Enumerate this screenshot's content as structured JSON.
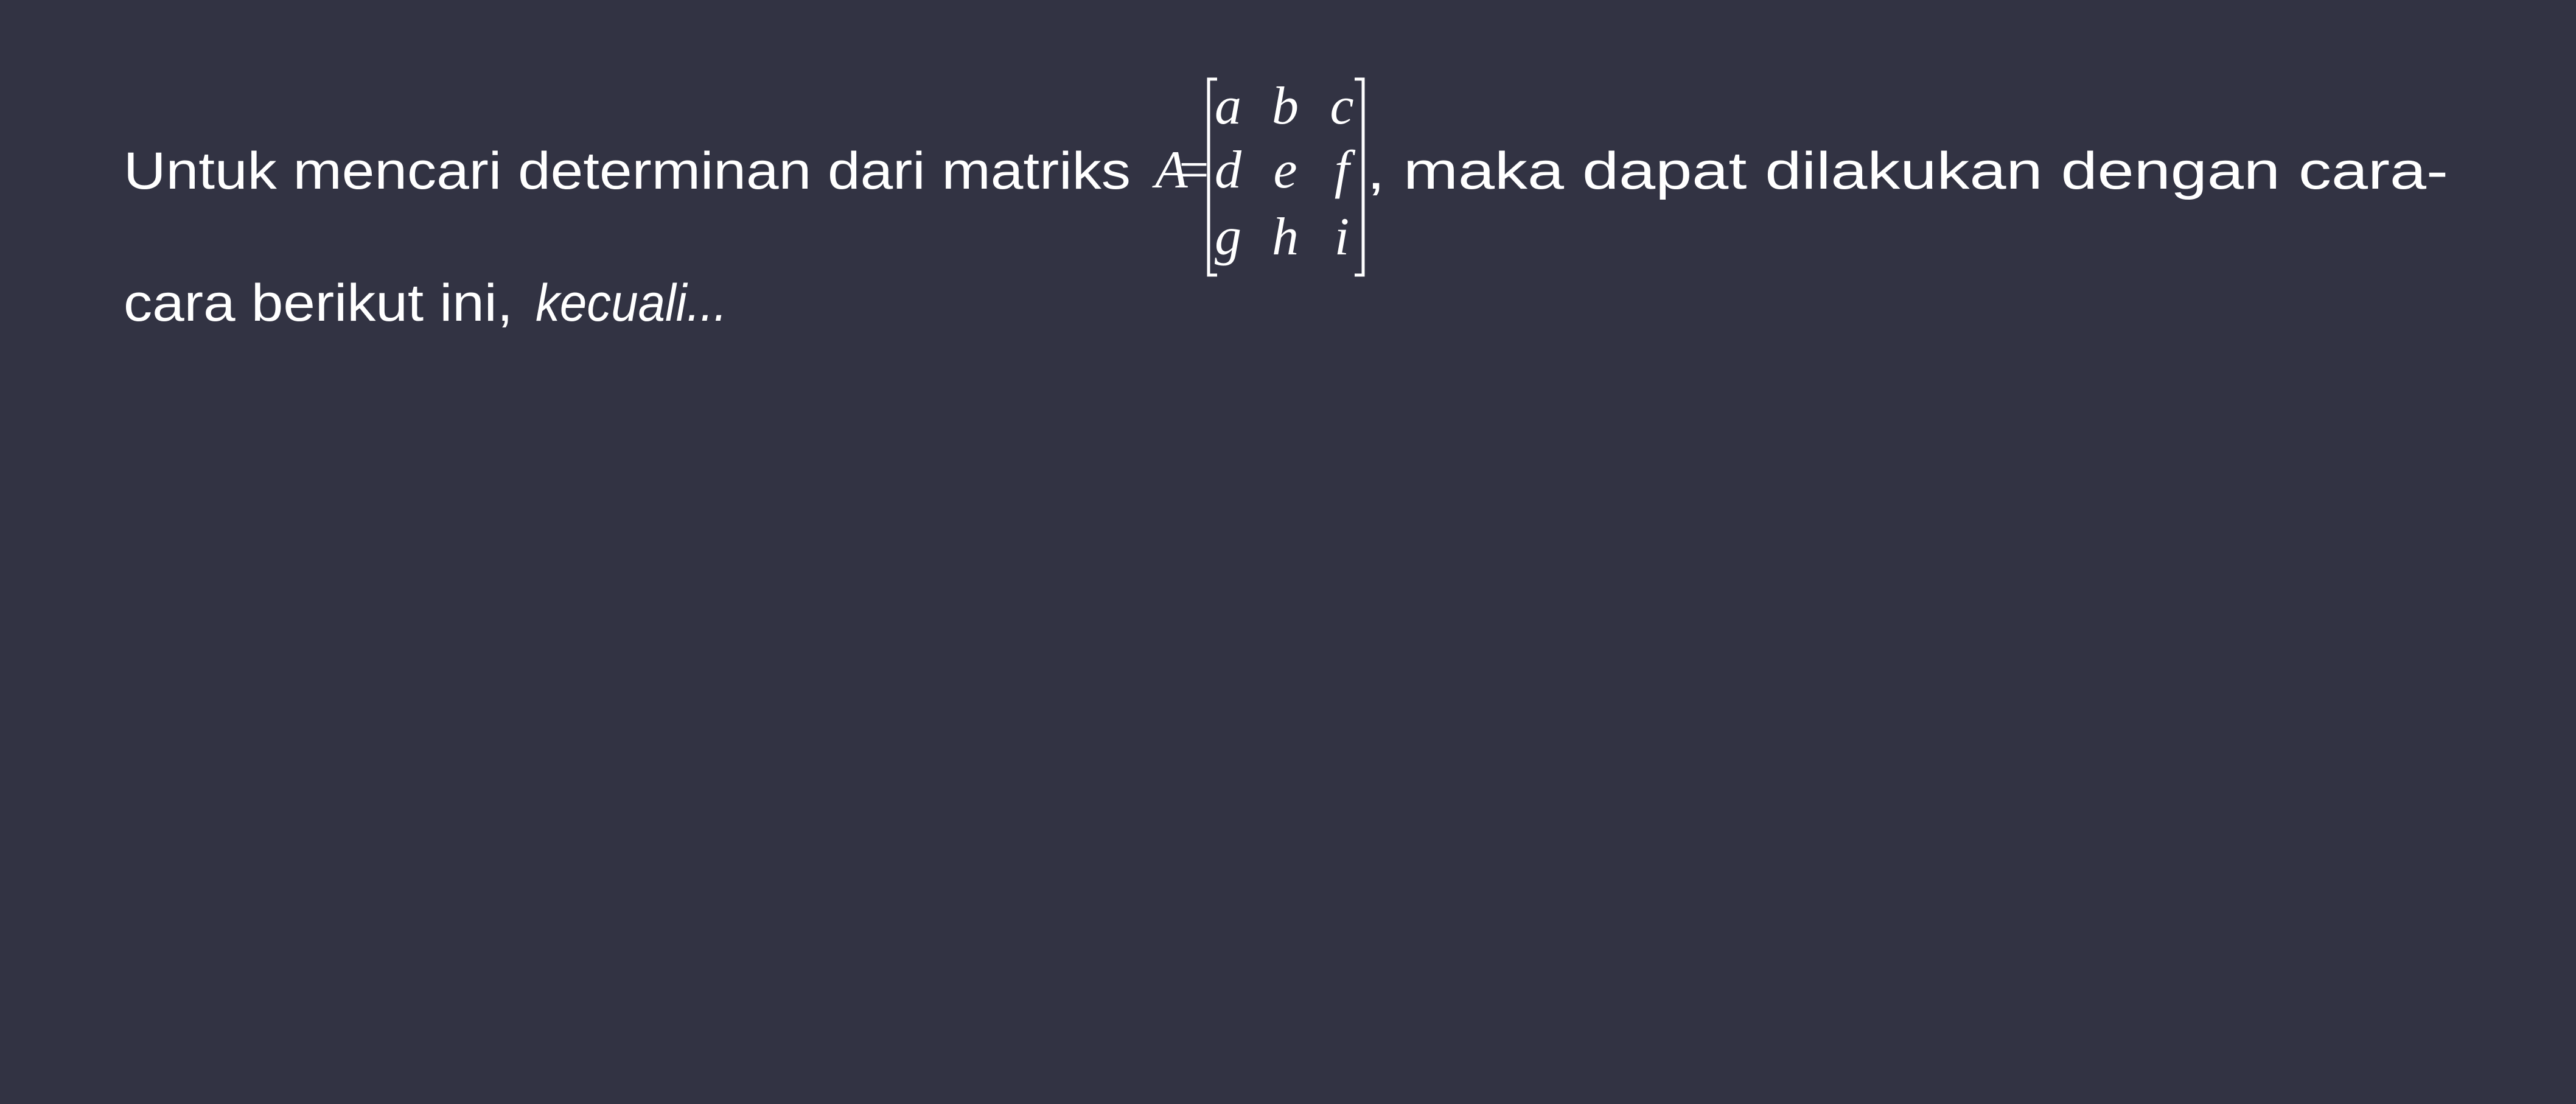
{
  "background_color": "#323343",
  "text_color": "#ffffff",
  "question": {
    "line1_before": "Untuk mencari determinan dari matriks",
    "matrix_name": "A",
    "equals": "=",
    "matrix": [
      [
        "a",
        "b",
        "c"
      ],
      [
        "d",
        "e",
        "f"
      ],
      [
        "g",
        "h",
        "i"
      ]
    ],
    "line1_after": ", maka dapat dilakukan dengan cara-",
    "line2": "cara berikut ini,",
    "emphasis": "kecuali..."
  }
}
